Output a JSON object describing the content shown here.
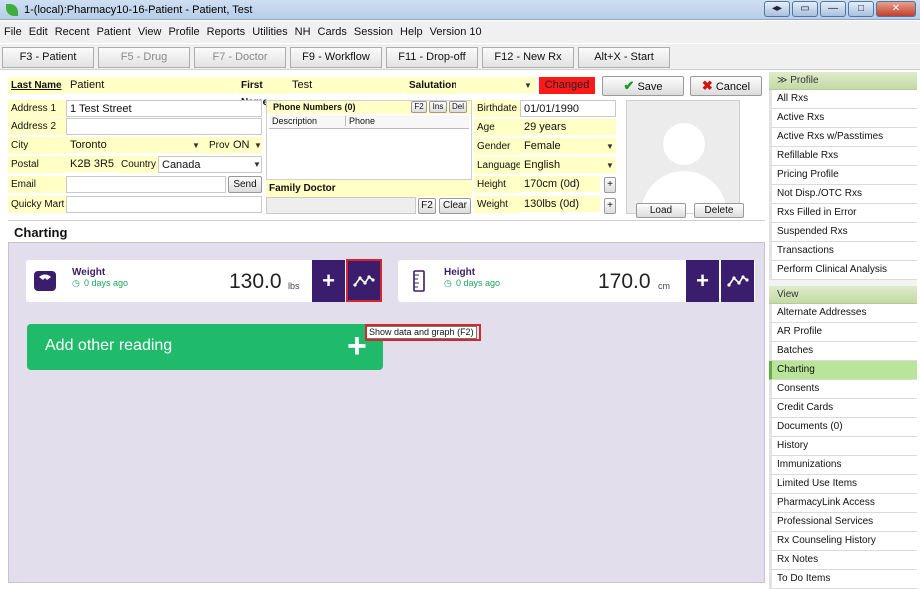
{
  "window": {
    "title": "1-(local):Pharmacy10-16-Patient - Patient, Test"
  },
  "menu": [
    "File",
    "Edit",
    "Recent",
    "Patient",
    "View",
    "Profile",
    "Reports",
    "Utilities",
    "NH",
    "Cards",
    "Session",
    "Help",
    "Version 10"
  ],
  "fkeys": [
    {
      "label": "F3 - Patient",
      "active": true
    },
    {
      "label": "F5 - Drug",
      "active": false
    },
    {
      "label": "F7 - Doctor",
      "active": false
    },
    {
      "label": "F9 - Workflow",
      "active": true
    },
    {
      "label": "F11 - Drop-off",
      "active": true
    },
    {
      "label": "F12 - New Rx",
      "active": true
    },
    {
      "label": "Alt+X - Start",
      "active": true
    }
  ],
  "patient": {
    "last_name_label": "Last Name",
    "last_name": "Patient",
    "first_name_label": "First Name",
    "first_name": "Test",
    "salutation_label": "Salutation",
    "salutation": "",
    "changed": "Changed",
    "address1_label": "Address 1",
    "address1": "1 Test Street",
    "address2_label": "Address 2",
    "address2": "",
    "city_label": "City",
    "city": "Toronto",
    "prov_label": "Prov",
    "prov": "ON",
    "postal_label": "Postal",
    "postal": "K2B 3R5",
    "country_label": "Country",
    "country": "Canada",
    "email_label": "Email",
    "email": "",
    "send": "Send",
    "quicky_label": "Quicky Mart",
    "quicky": ""
  },
  "phone": {
    "header": "Phone Numbers (0)",
    "btn_f2": "F2",
    "btn_ins": "Ins",
    "btn_del": "Del",
    "col_desc": "Description",
    "col_phone": "Phone"
  },
  "family_doctor": {
    "label": "Family Doctor",
    "f2": "F2",
    "clear": "Clear"
  },
  "demographics": {
    "birthdate_label": "Birthdate",
    "birthdate": "01/01/1990",
    "age_label": "Age",
    "age": "29 years",
    "gender_label": "Gender",
    "gender": "Female",
    "language_label": "Language",
    "language": "English",
    "height_label": "Height",
    "height": "170cm (0d)",
    "weight_label": "Weight",
    "weight": "130lbs (0d)",
    "plus": "+"
  },
  "photo": {
    "load": "Load",
    "delete": "Delete"
  },
  "actions": {
    "save": "Save",
    "cancel": "Cancel"
  },
  "charting": {
    "title": "Charting",
    "weight": {
      "name": "Weight",
      "ago": "0 days ago",
      "value": "130.0",
      "unit": "lbs"
    },
    "height": {
      "name": "Height",
      "ago": "0 days ago",
      "value": "170.0",
      "unit": "cm"
    },
    "add_reading": "Add other reading",
    "tooltip": "Show data and graph (F2)",
    "plus": "+"
  },
  "sidebar": {
    "profile_header": "Profile",
    "profile_items": [
      "All Rxs",
      "Active Rxs",
      "Active Rxs w/Passtimes",
      "Refillable Rxs",
      "Pricing Profile",
      "Not Disp./OTC Rxs",
      "Rxs Filled in Error",
      "Suspended Rxs",
      "Transactions",
      "Perform Clinical Analysis"
    ],
    "view_header": "View",
    "view_items": [
      "Alternate Addresses",
      "AR Profile",
      "Batches",
      "Charting",
      "Consents",
      "Credit Cards",
      "Documents (0)",
      "History",
      "Immunizations",
      "Limited Use Items",
      "PharmacyLink Access",
      "Professional Services",
      "Rx Counseling History",
      "Rx Notes",
      "To Do Items"
    ],
    "selected": "Charting"
  },
  "colors": {
    "accent": "#3a1e6d",
    "add_green": "#1fba6a",
    "changed_red": "#ff1a1a",
    "field_yellow": "#ffffc6",
    "selected_green": "#b8e59a"
  }
}
